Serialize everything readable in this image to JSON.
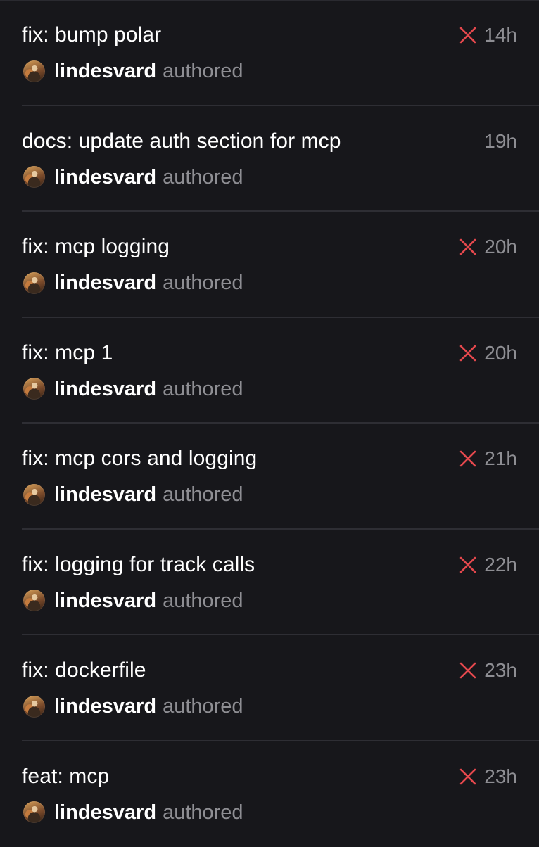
{
  "commits": [
    {
      "title": "fix: bump polar",
      "author": "lindesvard",
      "action": "authored",
      "time": "14h",
      "status": "failed"
    },
    {
      "title": "docs: update auth section for mcp",
      "author": "lindesvard",
      "action": "authored",
      "time": "19h",
      "status": "none"
    },
    {
      "title": "fix: mcp logging",
      "author": "lindesvard",
      "action": "authored",
      "time": "20h",
      "status": "failed"
    },
    {
      "title": "fix: mcp 1",
      "author": "lindesvard",
      "action": "authored",
      "time": "20h",
      "status": "failed"
    },
    {
      "title": "fix: mcp cors and logging",
      "author": "lindesvard",
      "action": "authored",
      "time": "21h",
      "status": "failed"
    },
    {
      "title": "fix: logging for track calls",
      "author": "lindesvard",
      "action": "authored",
      "time": "22h",
      "status": "failed"
    },
    {
      "title": "fix: dockerfile",
      "author": "lindesvard",
      "action": "authored",
      "time": "23h",
      "status": "failed"
    },
    {
      "title": "feat: mcp",
      "author": "lindesvard",
      "action": "authored",
      "time": "23h",
      "status": "failed"
    }
  ],
  "icons": {
    "failed": "x-mark-icon",
    "avatar": "avatar"
  },
  "colors": {
    "background": "#17171b",
    "divider": "#2e2e34",
    "failed": "#e5484d",
    "muted": "#8e8e93",
    "text": "#ffffff"
  }
}
